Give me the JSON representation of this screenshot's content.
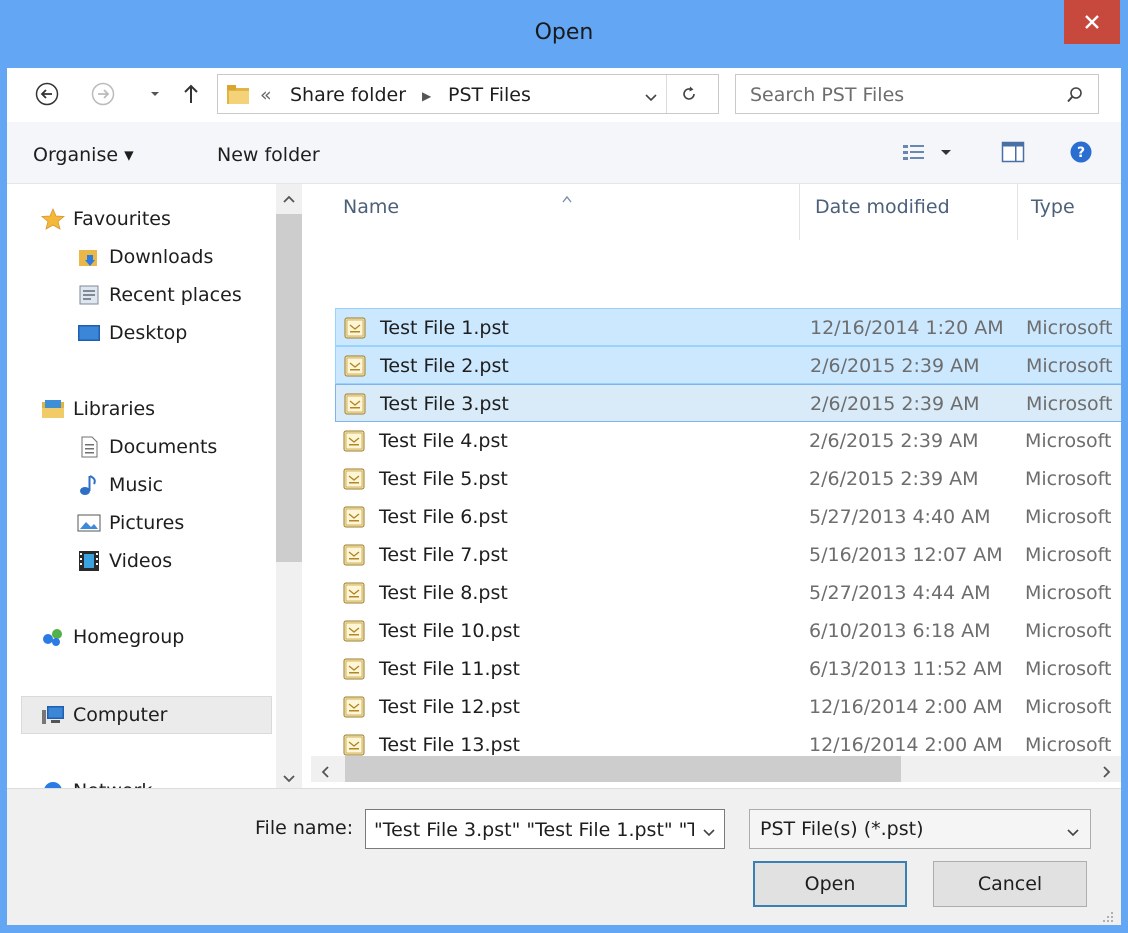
{
  "window": {
    "title": "Open"
  },
  "address": {
    "overflow": "«",
    "segments": [
      "Share folder",
      "PST Files"
    ]
  },
  "search": {
    "placeholder": "Search PST Files"
  },
  "toolbar": {
    "organise_label": "Organise ▾",
    "new_folder_label": "New folder"
  },
  "nav": {
    "favourites": "Favourites",
    "downloads": "Downloads",
    "recent": "Recent places",
    "desktop": "Desktop",
    "libraries": "Libraries",
    "documents": "Documents",
    "music": "Music",
    "pictures": "Pictures",
    "videos": "Videos",
    "homegroup": "Homegroup",
    "computer": "Computer",
    "network": "Network"
  },
  "columns": {
    "name": "Name",
    "date": "Date modified",
    "type": "Type"
  },
  "files": [
    {
      "name": "Test File 1.pst",
      "date": "12/16/2014 1:20 AM",
      "type": "Microsoft",
      "selected": true
    },
    {
      "name": "Test File 2.pst",
      "date": "2/6/2015 2:39 AM",
      "type": "Microsoft",
      "selected": true
    },
    {
      "name": "Test File 3.pst",
      "date": "2/6/2015 2:39 AM",
      "type": "Microsoft",
      "selected": true,
      "focused": true
    },
    {
      "name": "Test File 4.pst",
      "date": "2/6/2015 2:39 AM",
      "type": "Microsoft"
    },
    {
      "name": "Test File 5.pst",
      "date": "2/6/2015 2:39 AM",
      "type": "Microsoft"
    },
    {
      "name": "Test File 6.pst",
      "date": "5/27/2013 4:40 AM",
      "type": "Microsoft"
    },
    {
      "name": "Test File 7.pst",
      "date": "5/16/2013 12:07 AM",
      "type": "Microsoft"
    },
    {
      "name": "Test File 8.pst",
      "date": "5/27/2013 4:44 AM",
      "type": "Microsoft"
    },
    {
      "name": "Test File 10.pst",
      "date": "6/10/2013 6:18 AM",
      "type": "Microsoft"
    },
    {
      "name": "Test File 11.pst",
      "date": "6/13/2013 11:52 AM",
      "type": "Microsoft"
    },
    {
      "name": "Test File 12.pst",
      "date": "12/16/2014 2:00 AM",
      "type": "Microsoft"
    },
    {
      "name": "Test File 13.pst",
      "date": "12/16/2014 2:00 AM",
      "type": "Microsoft"
    }
  ],
  "filename": {
    "label": "File name:",
    "value": "\"Test File 3.pst\" \"Test File 1.pst\" \"T"
  },
  "filetype": {
    "value": "PST File(s) (*.pst)"
  },
  "buttons": {
    "open": "Open",
    "cancel": "Cancel"
  },
  "colors": {
    "title_bar": "#63a6f3",
    "close": "#c7483c",
    "selection": "#cce8ff",
    "selection_border": "#99d1ff"
  },
  "icons": [
    "back-arrow-icon",
    "forward-arrow-icon",
    "up-arrow-icon",
    "folder-icon",
    "refresh-icon",
    "search-icon",
    "view-options-icon",
    "preview-pane-icon",
    "help-icon",
    "star-icon",
    "pst-file-icon"
  ]
}
